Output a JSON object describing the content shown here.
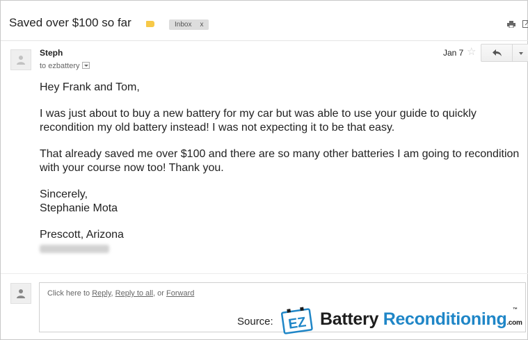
{
  "subject": "Saved over $100 so far",
  "labels": {
    "inbox": "Inbox",
    "remove": "x"
  },
  "message": {
    "sender": "Steph",
    "to": "to ezbattery",
    "date": "Jan 7",
    "greeting": "Hey Frank and Tom,",
    "paragraph1": "I was just about to buy a new battery for my car but was able to use your guide to quickly recondition my old battery instead! I was not expecting it to be that easy.",
    "paragraph2": "That already saved me over $100 and there are so many other batteries I am going to recondition with your course now too! Thank you.",
    "signoff": "Sincerely,",
    "name": "Stephanie Mota",
    "location": "Prescott, Arizona"
  },
  "reply": {
    "prefix": "Click here to ",
    "reply_link": "Reply",
    "sep1": ", ",
    "reply_all_link": "Reply to all",
    "sep2": ", or ",
    "forward_link": "Forward"
  },
  "watermark": {
    "source_label": "Source:",
    "badge": "EZ",
    "brand_part1": "Battery ",
    "brand_part2": "Reconditioning",
    "brand_suffix": ".com",
    "trademark": "™"
  },
  "colors": {
    "label_yellow": "#f7c948",
    "brand_blue": "#1f86c7",
    "inbox_chip": "#dddddd"
  },
  "icons": [
    "label-icon",
    "print-icon",
    "new-window-icon",
    "avatar-icon",
    "star-icon",
    "reply-icon",
    "more-icon",
    "dropdown-icon"
  ]
}
